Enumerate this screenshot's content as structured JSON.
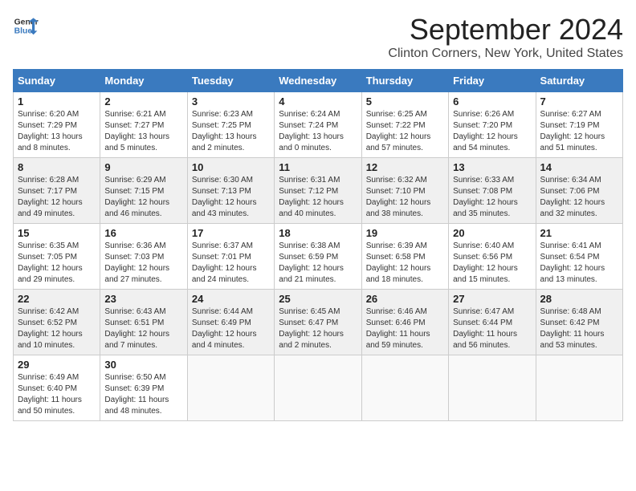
{
  "header": {
    "logo_line1": "General",
    "logo_line2": "Blue",
    "month_title": "September 2024",
    "location": "Clinton Corners, New York, United States"
  },
  "columns": [
    "Sunday",
    "Monday",
    "Tuesday",
    "Wednesday",
    "Thursday",
    "Friday",
    "Saturday"
  ],
  "weeks": [
    [
      {
        "day": "1",
        "info": "Sunrise: 6:20 AM\nSunset: 7:29 PM\nDaylight: 13 hours and 8 minutes."
      },
      {
        "day": "2",
        "info": "Sunrise: 6:21 AM\nSunset: 7:27 PM\nDaylight: 13 hours and 5 minutes."
      },
      {
        "day": "3",
        "info": "Sunrise: 6:23 AM\nSunset: 7:25 PM\nDaylight: 13 hours and 2 minutes."
      },
      {
        "day": "4",
        "info": "Sunrise: 6:24 AM\nSunset: 7:24 PM\nDaylight: 13 hours and 0 minutes."
      },
      {
        "day": "5",
        "info": "Sunrise: 6:25 AM\nSunset: 7:22 PM\nDaylight: 12 hours and 57 minutes."
      },
      {
        "day": "6",
        "info": "Sunrise: 6:26 AM\nSunset: 7:20 PM\nDaylight: 12 hours and 54 minutes."
      },
      {
        "day": "7",
        "info": "Sunrise: 6:27 AM\nSunset: 7:19 PM\nDaylight: 12 hours and 51 minutes."
      }
    ],
    [
      {
        "day": "8",
        "info": "Sunrise: 6:28 AM\nSunset: 7:17 PM\nDaylight: 12 hours and 49 minutes."
      },
      {
        "day": "9",
        "info": "Sunrise: 6:29 AM\nSunset: 7:15 PM\nDaylight: 12 hours and 46 minutes."
      },
      {
        "day": "10",
        "info": "Sunrise: 6:30 AM\nSunset: 7:13 PM\nDaylight: 12 hours and 43 minutes."
      },
      {
        "day": "11",
        "info": "Sunrise: 6:31 AM\nSunset: 7:12 PM\nDaylight: 12 hours and 40 minutes."
      },
      {
        "day": "12",
        "info": "Sunrise: 6:32 AM\nSunset: 7:10 PM\nDaylight: 12 hours and 38 minutes."
      },
      {
        "day": "13",
        "info": "Sunrise: 6:33 AM\nSunset: 7:08 PM\nDaylight: 12 hours and 35 minutes."
      },
      {
        "day": "14",
        "info": "Sunrise: 6:34 AM\nSunset: 7:06 PM\nDaylight: 12 hours and 32 minutes."
      }
    ],
    [
      {
        "day": "15",
        "info": "Sunrise: 6:35 AM\nSunset: 7:05 PM\nDaylight: 12 hours and 29 minutes."
      },
      {
        "day": "16",
        "info": "Sunrise: 6:36 AM\nSunset: 7:03 PM\nDaylight: 12 hours and 27 minutes."
      },
      {
        "day": "17",
        "info": "Sunrise: 6:37 AM\nSunset: 7:01 PM\nDaylight: 12 hours and 24 minutes."
      },
      {
        "day": "18",
        "info": "Sunrise: 6:38 AM\nSunset: 6:59 PM\nDaylight: 12 hours and 21 minutes."
      },
      {
        "day": "19",
        "info": "Sunrise: 6:39 AM\nSunset: 6:58 PM\nDaylight: 12 hours and 18 minutes."
      },
      {
        "day": "20",
        "info": "Sunrise: 6:40 AM\nSunset: 6:56 PM\nDaylight: 12 hours and 15 minutes."
      },
      {
        "day": "21",
        "info": "Sunrise: 6:41 AM\nSunset: 6:54 PM\nDaylight: 12 hours and 13 minutes."
      }
    ],
    [
      {
        "day": "22",
        "info": "Sunrise: 6:42 AM\nSunset: 6:52 PM\nDaylight: 12 hours and 10 minutes."
      },
      {
        "day": "23",
        "info": "Sunrise: 6:43 AM\nSunset: 6:51 PM\nDaylight: 12 hours and 7 minutes."
      },
      {
        "day": "24",
        "info": "Sunrise: 6:44 AM\nSunset: 6:49 PM\nDaylight: 12 hours and 4 minutes."
      },
      {
        "day": "25",
        "info": "Sunrise: 6:45 AM\nSunset: 6:47 PM\nDaylight: 12 hours and 2 minutes."
      },
      {
        "day": "26",
        "info": "Sunrise: 6:46 AM\nSunset: 6:46 PM\nDaylight: 11 hours and 59 minutes."
      },
      {
        "day": "27",
        "info": "Sunrise: 6:47 AM\nSunset: 6:44 PM\nDaylight: 11 hours and 56 minutes."
      },
      {
        "day": "28",
        "info": "Sunrise: 6:48 AM\nSunset: 6:42 PM\nDaylight: 11 hours and 53 minutes."
      }
    ],
    [
      {
        "day": "29",
        "info": "Sunrise: 6:49 AM\nSunset: 6:40 PM\nDaylight: 11 hours and 50 minutes."
      },
      {
        "day": "30",
        "info": "Sunrise: 6:50 AM\nSunset: 6:39 PM\nDaylight: 11 hours and 48 minutes."
      },
      {
        "day": "",
        "info": ""
      },
      {
        "day": "",
        "info": ""
      },
      {
        "day": "",
        "info": ""
      },
      {
        "day": "",
        "info": ""
      },
      {
        "day": "",
        "info": ""
      }
    ]
  ]
}
